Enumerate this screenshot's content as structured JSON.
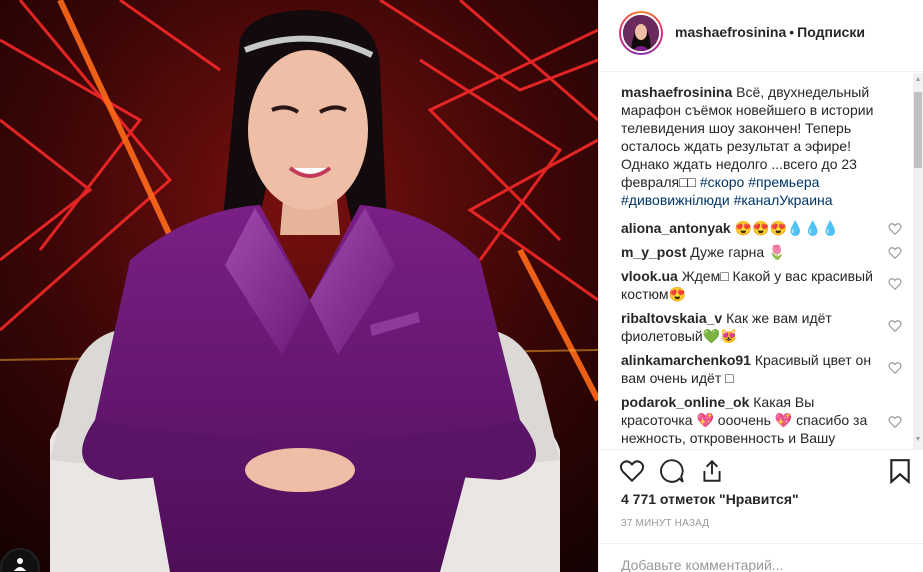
{
  "post": {
    "username": "mashaefrosinina",
    "separator": "•",
    "follow_label": "Подписки",
    "caption": {
      "username": "mashaefrosinina",
      "text": "Всё, двухнедельный марафон съёмок новейшего в истории телевидения шоу закончен! Теперь осталось ждать результат а эфире! Однако ждать недолго ...всего до 23 февраля",
      "glyphs": "□□",
      "tags": [
        "#скоро",
        "#премьера",
        "#дивовижнілюди",
        "#каналУкраина"
      ]
    }
  },
  "comments": [
    {
      "user": "aliona_antonyak",
      "text": "😍😍😍💧💧💧"
    },
    {
      "user": "m_y_post",
      "text": "Дуже гарна 🌷"
    },
    {
      "user": "vlook.ua",
      "text": "Ждем□ Какой у вас красивый костюм😍"
    },
    {
      "user": "ribaltovskaia_v",
      "text": "Как же вам идёт фиолетовый💚😻"
    },
    {
      "user": "alinkamarchenko91",
      "text": "Красивый цвет он вам очень идёт □"
    },
    {
      "user": "podarok_online_ok",
      "text": "Какая Вы красоточка 💖 ооочень 💖 спасибо за нежность, откровенность и Вашу"
    }
  ],
  "actions": {
    "likes_text": "4 771 отметок \"Нравится\"",
    "timestamp": "37 МИНУТ НАЗАД",
    "comment_placeholder": "Добавьте комментарий..."
  },
  "icons": {
    "like": "heart-icon",
    "comment": "comment-icon",
    "share": "share-icon",
    "save": "bookmark-icon",
    "comment_like": "small-heart-icon"
  },
  "colors": {
    "text": "#262626",
    "hashtag": "#003569",
    "muted": "#999999",
    "border": "#efefef",
    "story_ring": [
      "#f58529",
      "#dd2a7b",
      "#8134af"
    ]
  }
}
